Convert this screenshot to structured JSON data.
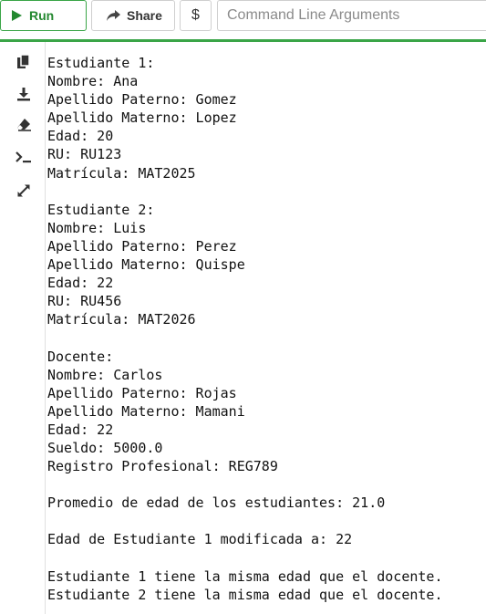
{
  "toolbar": {
    "run_label": "Run",
    "share_label": "Share",
    "dollar_label": "$",
    "args_placeholder": "Command Line Arguments"
  },
  "side_toolbar": {
    "icons": [
      "copy-icon",
      "download-icon",
      "eraser-icon",
      "terminal-icon",
      "expand-icon"
    ]
  },
  "console": {
    "lines": [
      "Estudiante 1:",
      "Nombre: Ana",
      "Apellido Paterno: Gomez",
      "Apellido Materno: Lopez",
      "Edad: 20",
      "RU: RU123",
      "Matrícula: MAT2025",
      "",
      "Estudiante 2:",
      "Nombre: Luis",
      "Apellido Paterno: Perez",
      "Apellido Materno: Quispe",
      "Edad: 22",
      "RU: RU456",
      "Matrícula: MAT2026",
      "",
      "Docente:",
      "Nombre: Carlos",
      "Apellido Paterno: Rojas",
      "Apellido Materno: Mamani",
      "Edad: 22",
      "Sueldo: 5000.0",
      "Registro Profesional: REG789",
      "",
      "Promedio de edad de los estudiantes: 21.0",
      "",
      "Edad de Estudiante 1 modificada a: 22",
      "",
      "Estudiante 1 tiene la misma edad que el docente.",
      "Estudiante 2 tiene la misma edad que el docente."
    ]
  },
  "colors": {
    "accent_green": "#3aa547",
    "run_text": "#23882f"
  }
}
